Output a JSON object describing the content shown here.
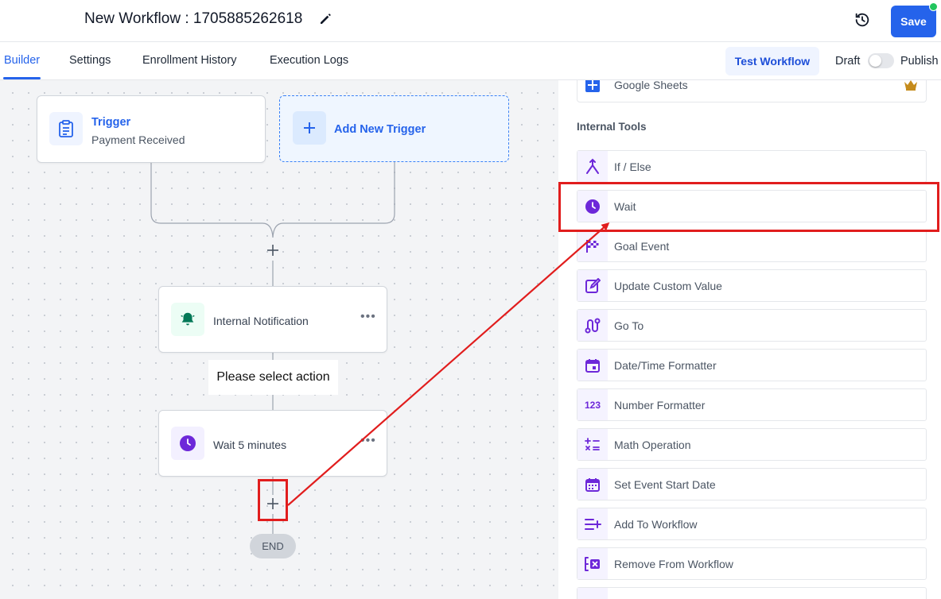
{
  "header": {
    "title": "New Workflow : 1705885262618",
    "save_label": "Save"
  },
  "tabs": {
    "builder": "Builder",
    "settings": "Settings",
    "enrollment_history": "Enrollment History",
    "execution_logs": "Execution Logs",
    "test_workflow": "Test Workflow",
    "draft": "Draft",
    "publish": "Publish"
  },
  "canvas": {
    "trigger_title": "Trigger",
    "trigger_subtitle": "Payment Received",
    "add_trigger": "Add New Trigger",
    "notification_action": "Internal Notification",
    "tooltip": "Please select action",
    "wait_action": "Wait 5 minutes",
    "end_label": "END"
  },
  "panel": {
    "top_item": "Google Sheets",
    "section_title": "Internal Tools",
    "tools": [
      {
        "label": "If / Else",
        "icon": "split-icon"
      },
      {
        "label": "Wait",
        "icon": "clock-icon"
      },
      {
        "label": "Goal Event",
        "icon": "flag-icon"
      },
      {
        "label": "Update Custom Value",
        "icon": "edit-icon"
      },
      {
        "label": "Go To",
        "icon": "route-icon"
      },
      {
        "label": "Date/Time Formatter",
        "icon": "calendar-icon"
      },
      {
        "label": "Number Formatter",
        "icon": "number-123-icon"
      },
      {
        "label": "Math Operation",
        "icon": "math-icon"
      },
      {
        "label": "Set Event Start Date",
        "icon": "calendar-icon"
      },
      {
        "label": "Add To Workflow",
        "icon": "list-add-icon"
      },
      {
        "label": "Remove From Workflow",
        "icon": "list-remove-icon"
      }
    ]
  },
  "colors": {
    "primary": "#2563eb",
    "tool_icon": "#7c3aed",
    "annotation": "#e11d1d",
    "notification_icon": "#047857"
  }
}
